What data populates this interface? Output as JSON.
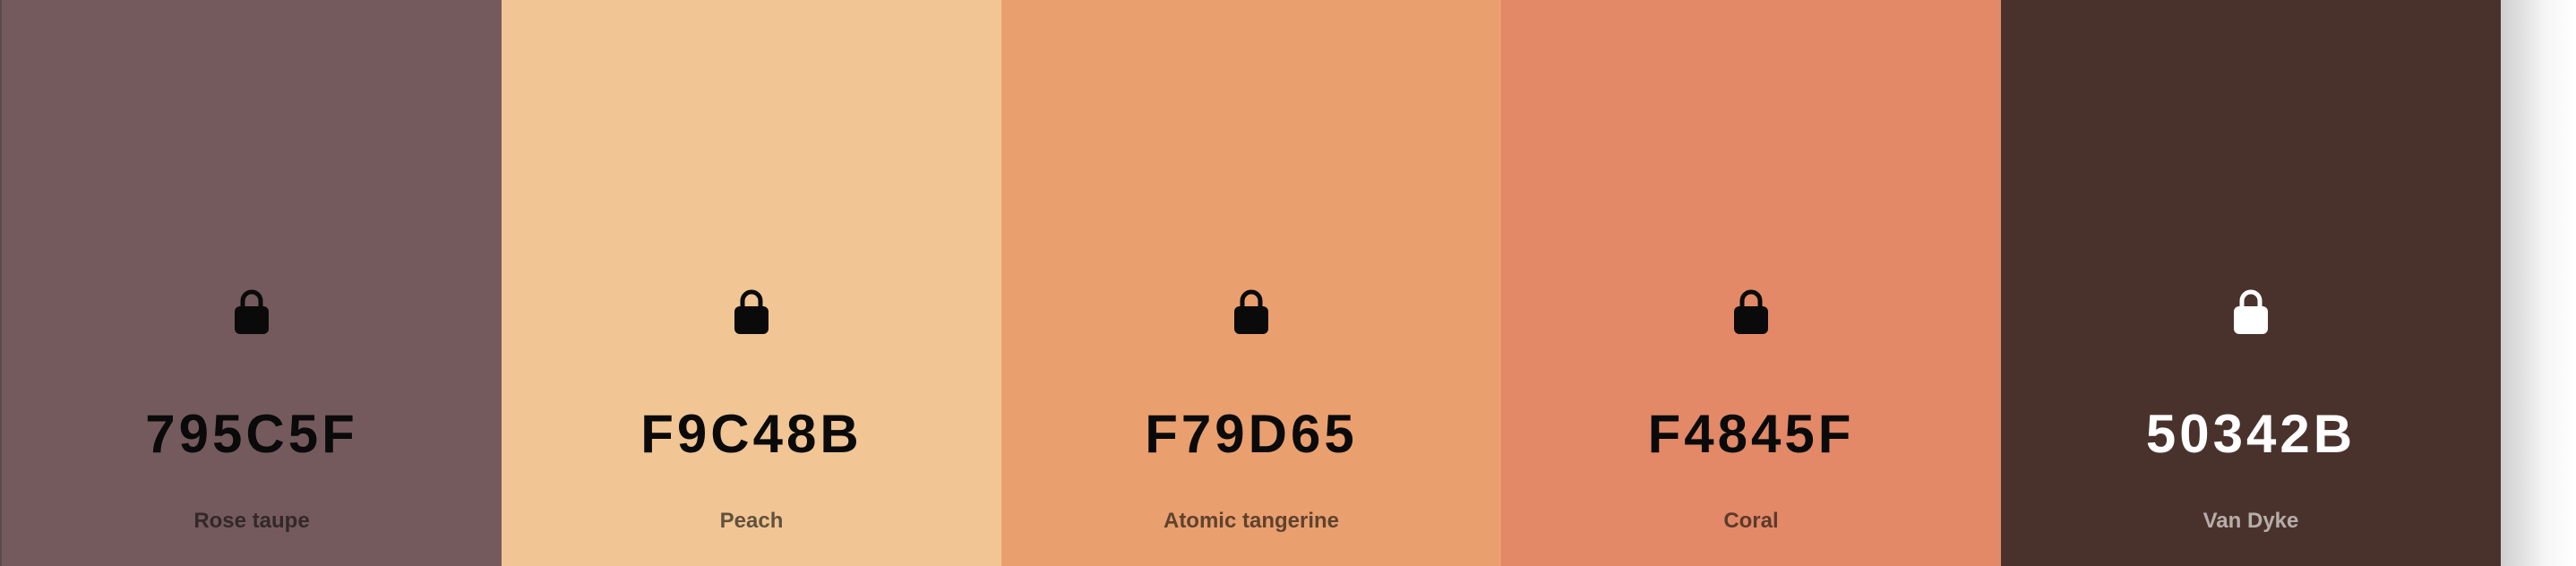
{
  "palette": {
    "colors": [
      {
        "hex": "795C5F",
        "name": "Rose taupe",
        "swatch": "#755a5d",
        "text": "#0a0a0a",
        "lock_icon": "lock-icon"
      },
      {
        "hex": "F9C48B",
        "name": "Peach",
        "swatch": "#f1c694",
        "text": "#0a0a0a",
        "lock_icon": "lock-icon"
      },
      {
        "hex": "F79D65",
        "name": "Atomic tangerine",
        "swatch": "#ea9f6e",
        "text": "#0a0a0a",
        "lock_icon": "lock-icon"
      },
      {
        "hex": "F4845F",
        "name": "Coral",
        "swatch": "#e38967",
        "text": "#0a0a0a",
        "lock_icon": "lock-icon"
      },
      {
        "hex": "50342B",
        "name": "Van Dyke",
        "swatch": "#4a322c",
        "text": "#ffffff",
        "lock_icon": "lock-icon"
      }
    ]
  }
}
